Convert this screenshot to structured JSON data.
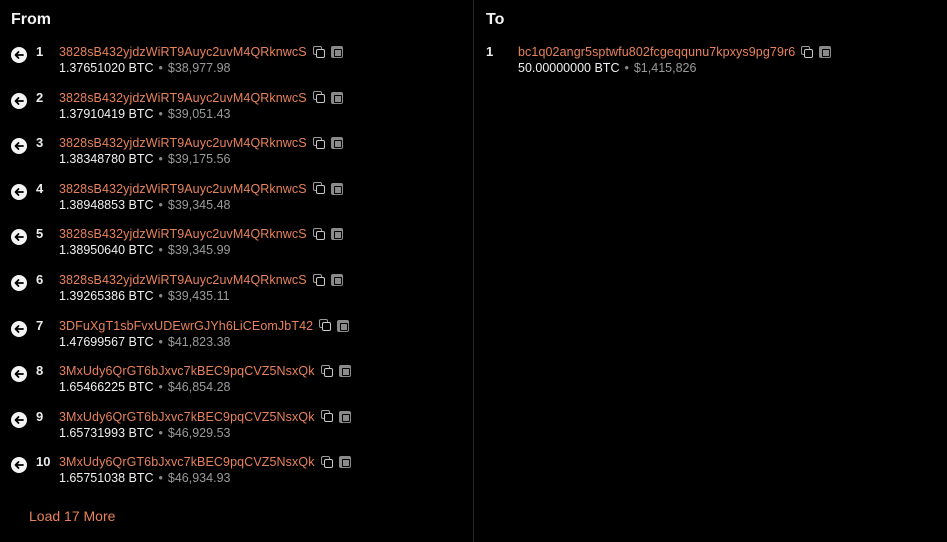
{
  "from": {
    "title": "From",
    "items": [
      {
        "index": "1",
        "address": "3828sB432yjdzWiRT9Auyc2uvM4QRknwcS",
        "btc": "1.37651020 BTC",
        "usd": "$38,977.98"
      },
      {
        "index": "2",
        "address": "3828sB432yjdzWiRT9Auyc2uvM4QRknwcS",
        "btc": "1.37910419 BTC",
        "usd": "$39,051.43"
      },
      {
        "index": "3",
        "address": "3828sB432yjdzWiRT9Auyc2uvM4QRknwcS",
        "btc": "1.38348780 BTC",
        "usd": "$39,175.56"
      },
      {
        "index": "4",
        "address": "3828sB432yjdzWiRT9Auyc2uvM4QRknwcS",
        "btc": "1.38948853 BTC",
        "usd": "$39,345.48"
      },
      {
        "index": "5",
        "address": "3828sB432yjdzWiRT9Auyc2uvM4QRknwcS",
        "btc": "1.38950640 BTC",
        "usd": "$39,345.99"
      },
      {
        "index": "6",
        "address": "3828sB432yjdzWiRT9Auyc2uvM4QRknwcS",
        "btc": "1.39265386 BTC",
        "usd": "$39,435.11"
      },
      {
        "index": "7",
        "address": "3DFuXgT1sbFvxUDEwrGJYh6LiCEomJbT42",
        "btc": "1.47699567 BTC",
        "usd": "$41,823.38"
      },
      {
        "index": "8",
        "address": "3MxUdy6QrGT6bJxvc7kBEC9pqCVZ5NsxQk",
        "btc": "1.65466225 BTC",
        "usd": "$46,854.28"
      },
      {
        "index": "9",
        "address": "3MxUdy6QrGT6bJxvc7kBEC9pqCVZ5NsxQk",
        "btc": "1.65731993 BTC",
        "usd": "$46,929.53"
      },
      {
        "index": "10",
        "address": "3MxUdy6QrGT6bJxvc7kBEC9pqCVZ5NsxQk",
        "btc": "1.65751038 BTC",
        "usd": "$46,934.93"
      }
    ],
    "load_more_label": "Load 17 More"
  },
  "to": {
    "title": "To",
    "items": [
      {
        "index": "1",
        "address": "bc1q02angr5sptwfu802fcgeqqunu7kpxys9pg79r6",
        "btc": "50.00000000 BTC",
        "usd": "$1,415,826"
      }
    ]
  },
  "separator": "•",
  "icons": {
    "input": "arrow-left-circle-icon",
    "copy": "copy-icon",
    "qr": "qr-code-icon"
  },
  "colors": {
    "background": "#000000",
    "address": "#e8825a",
    "muted": "#9a9a9a"
  }
}
